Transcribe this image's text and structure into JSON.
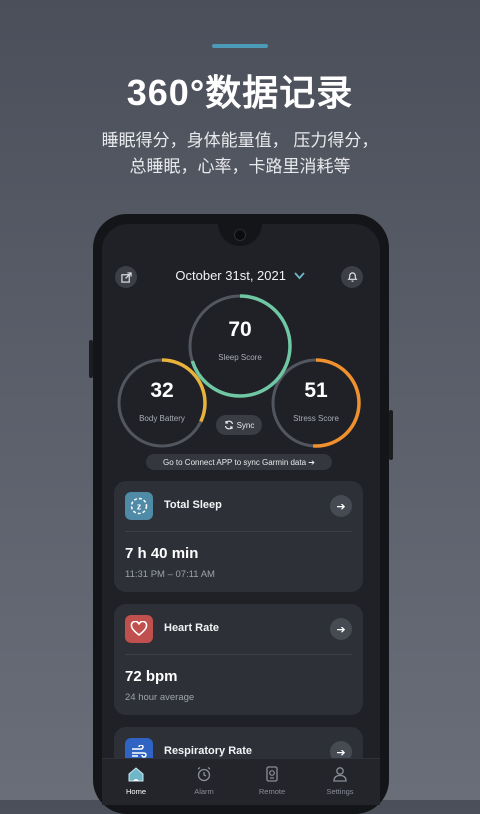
{
  "promo": {
    "headline": "360°数据记录",
    "line1": "睡眠得分，身体能量值，  压力得分，",
    "line2": "总睡眠，心率，卡路里消耗等"
  },
  "header": {
    "date": "October 31st, 2021",
    "chevron": "⌄"
  },
  "scores": {
    "sleep": {
      "value": "70",
      "label": "Sleep Score",
      "color": "#6fc7a4",
      "fraction": 0.7
    },
    "body_battery": {
      "value": "32",
      "label": "Body Battery",
      "color": "#e9b23c",
      "fraction": 0.32
    },
    "stress": {
      "value": "51",
      "label": "Stress Score",
      "color": "#f1902f",
      "fraction": 0.51
    }
  },
  "sync_label": "Sync",
  "connect_text": "Go to Connect APP to sync Garmin data ➔",
  "cards": {
    "total_sleep": {
      "title": "Total Sleep",
      "value": "7 h 40 min",
      "sub": "11:31 PM – 07:11 AM",
      "icon_color": "#4f8aa6"
    },
    "heart_rate": {
      "title": "Heart Rate",
      "value": "72 bpm",
      "sub": "24 hour average",
      "icon_color": "#c0504d"
    },
    "respiratory": {
      "title": "Respiratory Rate",
      "icon_color": "#2f64c4"
    }
  },
  "arrow": "➔",
  "tabs": [
    {
      "label": "Home",
      "icon": "home-icon",
      "active": true
    },
    {
      "label": "Alarm",
      "icon": "alarm-icon",
      "active": false
    },
    {
      "label": "Remote",
      "icon": "remote-icon",
      "active": false
    },
    {
      "label": "Settings",
      "icon": "user-icon",
      "active": false
    }
  ]
}
